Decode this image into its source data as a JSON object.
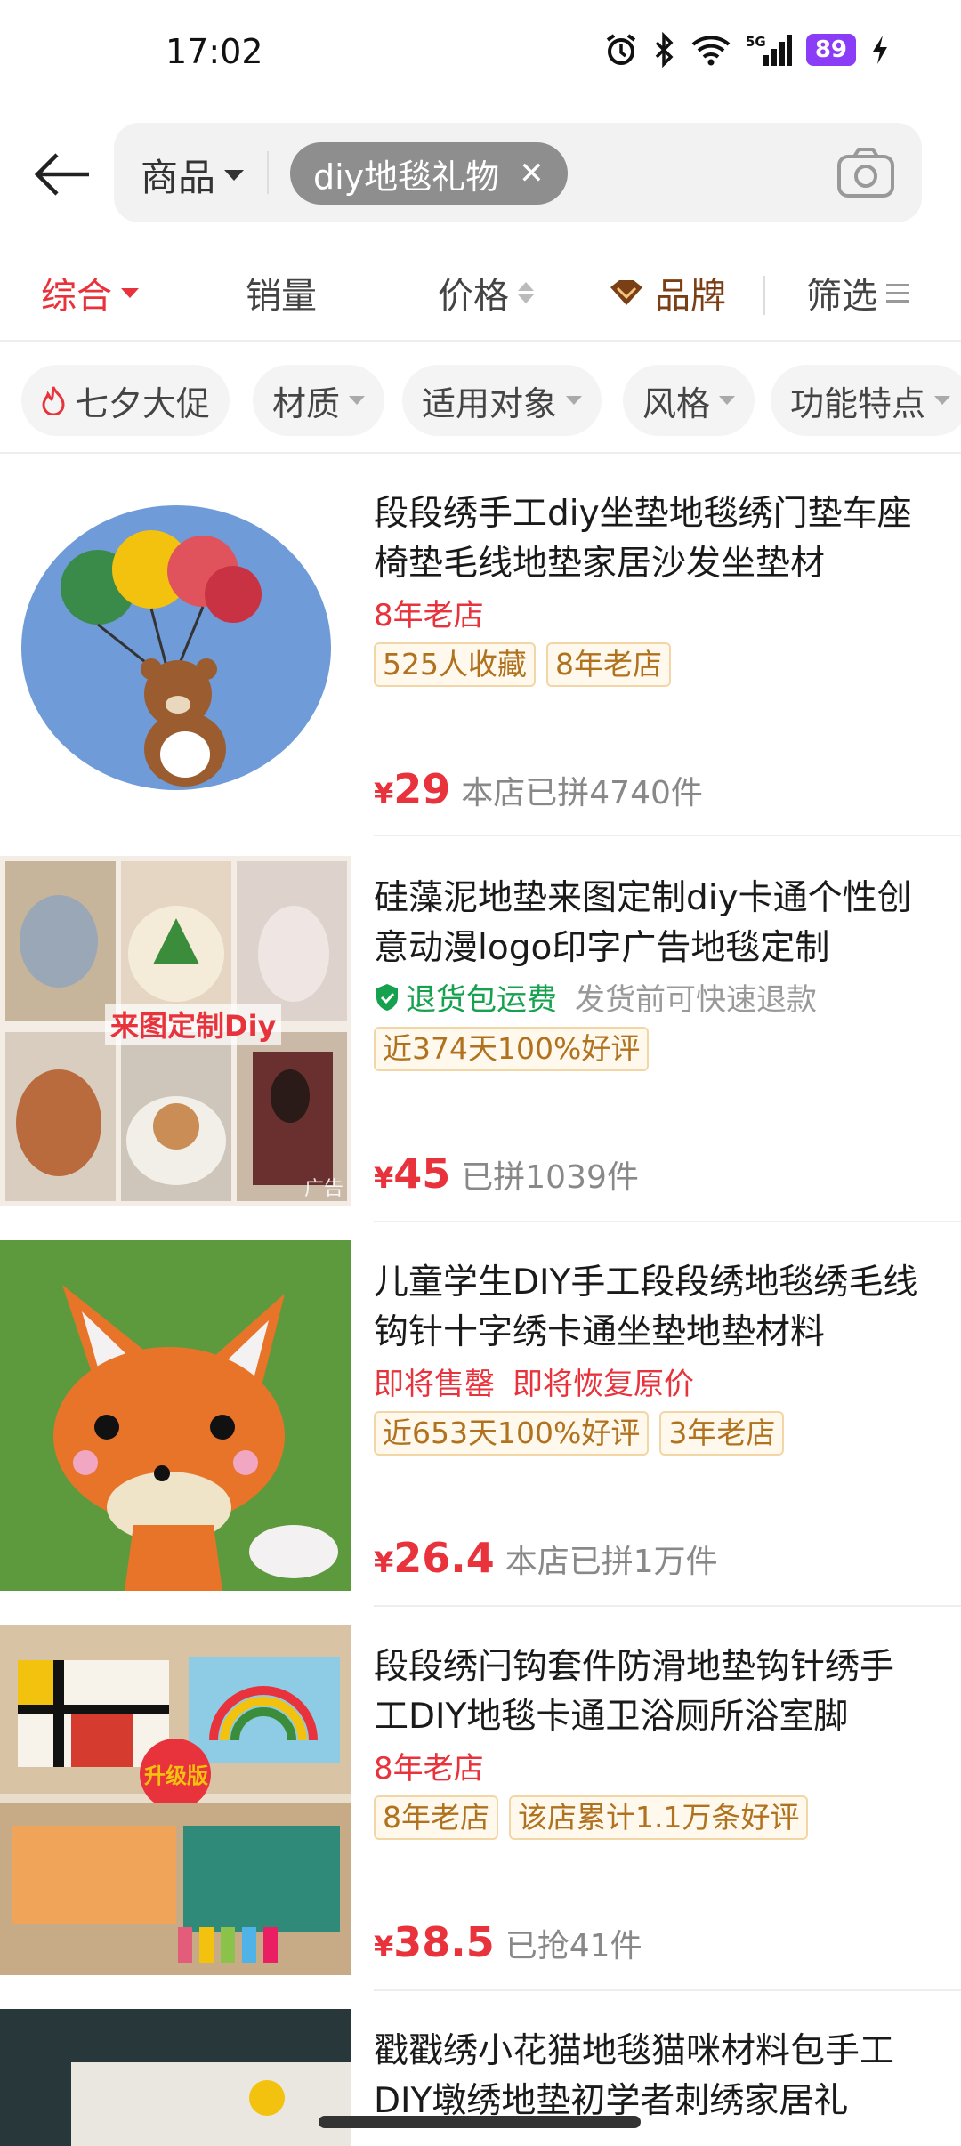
{
  "status": {
    "time": "17:02",
    "battery": "89",
    "network": "5G"
  },
  "search": {
    "scope": "商品",
    "query": "diy地毯礼物"
  },
  "sort_tabs": [
    {
      "label": "综合",
      "active": true
    },
    {
      "label": "销量"
    },
    {
      "label": "价格"
    },
    {
      "label": "品牌"
    },
    {
      "label": "筛选"
    }
  ],
  "filter_chips": [
    "七夕大促",
    "材质",
    "适用对象",
    "风格",
    "功能特点"
  ],
  "products": [
    {
      "title": "段段绣手工diy坐垫地毯绣门垫车座椅垫毛线地垫家居沙发坐垫材",
      "sub": [
        "8年老店"
      ],
      "tags": [
        "525人收藏",
        "8年老店"
      ],
      "price": "29",
      "sales": "本店已拼4740件"
    },
    {
      "title": "硅藻泥地垫来图定制diy卡通个性创意动漫logo印字广告地毯定制",
      "sub_green": "退货包运费",
      "sub_gray": "发货前可快速退款",
      "tags": [
        "近374天100%好评"
      ],
      "price": "45",
      "sales": "已拼1039件",
      "ad": "广告",
      "overlay_text": "来图定制Diy"
    },
    {
      "title": "儿童学生DIY手工段段绣地毯绣毛线钩针十字绣卡通坐垫地垫材料",
      "sub": [
        "即将售罄",
        "即将恢复原价"
      ],
      "tags": [
        "近653天100%好评",
        "3年老店"
      ],
      "price": "26.4",
      "sales": "本店已拼1万件"
    },
    {
      "title": "段段绣闩钩套件防滑地垫钩针绣手工DIY地毯卡通卫浴厕所浴室脚",
      "sub": [
        "8年老店"
      ],
      "tags": [
        "8年老店",
        "该店累计1.1万条好评"
      ],
      "price": "38.5",
      "sales": "已抢41件",
      "overlay_text": "升级版"
    },
    {
      "title": "戳戳绣小花猫地毯猫咪材料包手工DIY墩绣地垫初学者刺绣家居礼"
    }
  ],
  "colors": {
    "accent": "#e8323c",
    "brand": "#7b3f16",
    "tag_text": "#b0721e",
    "green": "#15a14e"
  },
  "icons": [
    "back-arrow-icon",
    "camera-icon",
    "alarm-icon",
    "bluetooth-icon",
    "wifi-icon",
    "signal-icon",
    "charging-icon",
    "fire-icon",
    "shield-check-icon",
    "brand-diamond-icon",
    "filter-lines-icon"
  ]
}
